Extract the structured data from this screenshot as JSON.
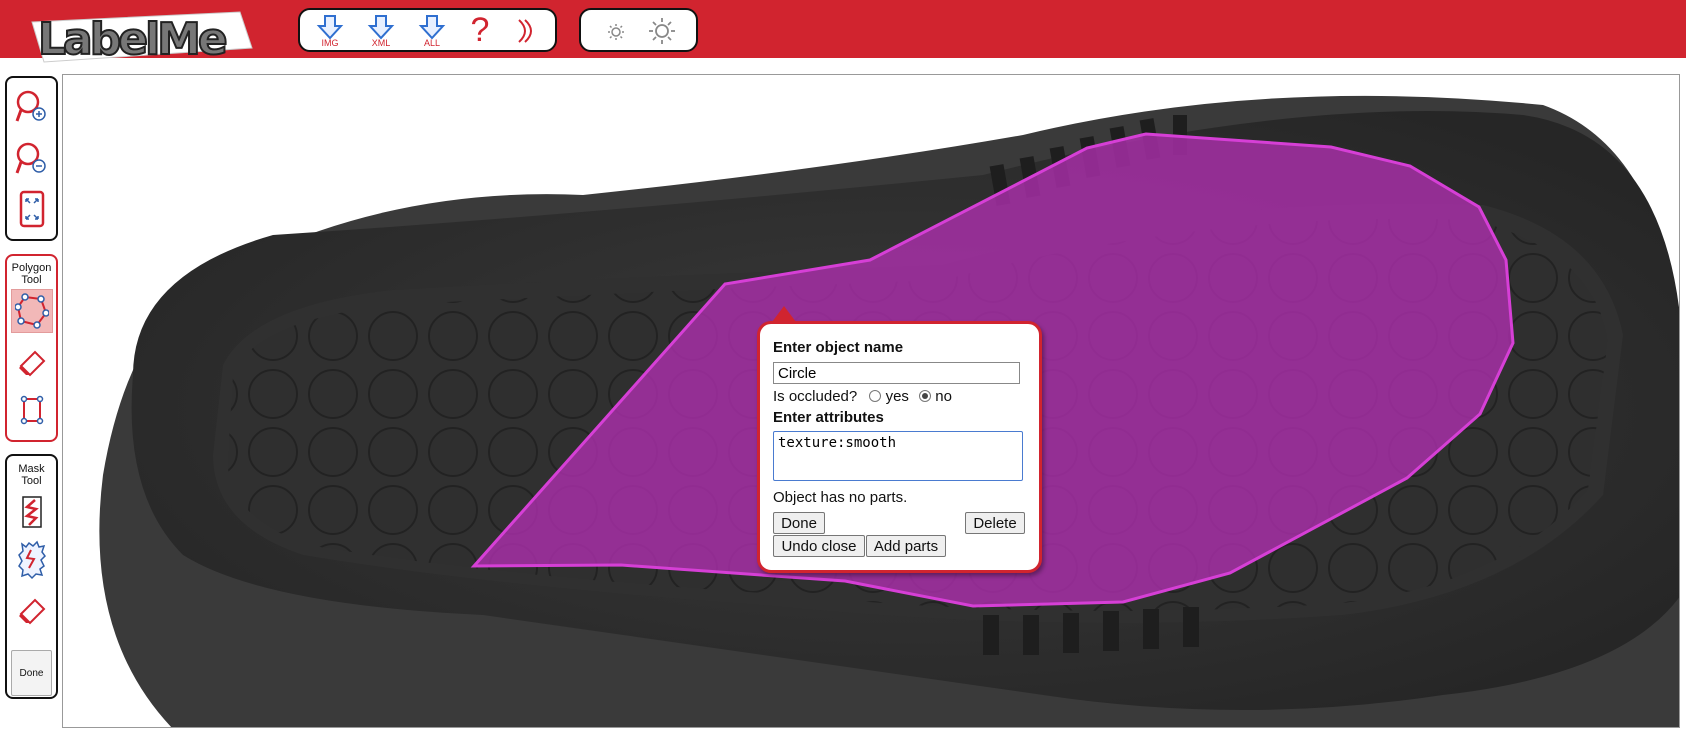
{
  "app": {
    "logo_text": "LabelMe"
  },
  "toolbar": {
    "download_img": "IMG",
    "download_xml": "XML",
    "download_all": "ALL",
    "help_glyph": "?"
  },
  "sidebar": {
    "polygon_title_line1": "Polygon",
    "polygon_title_line2": "Tool",
    "mask_title_line1": "Mask",
    "mask_title_line2": "Tool",
    "mask_done_label": "Done"
  },
  "popup": {
    "name_heading": "Enter object name",
    "name_value": "Circle",
    "occluded_label": "Is occluded?",
    "occluded_yes": "yes",
    "occluded_no": "no",
    "attributes_heading": "Enter attributes",
    "attributes_value": "texture:smooth",
    "parts_text": "Object has no parts.",
    "done_button": "Done",
    "delete_button": "Delete",
    "undo_close_button": "Undo close",
    "add_parts_button": "Add parts"
  },
  "colors": {
    "brand_red": "#d1242f",
    "polygon_stroke": "#d63fd6",
    "polygon_fill": "#b12fb1"
  },
  "icons": [
    "download-icon",
    "help-icon",
    "signout-icon",
    "brightness-low-icon",
    "brightness-high-icon",
    "zoom-in-icon",
    "zoom-out-icon",
    "fit-screen-icon",
    "polygon-icon",
    "eraser-icon",
    "bounding-box-icon",
    "scribble-icon",
    "mask-region-icon",
    "mask-eraser-icon"
  ]
}
